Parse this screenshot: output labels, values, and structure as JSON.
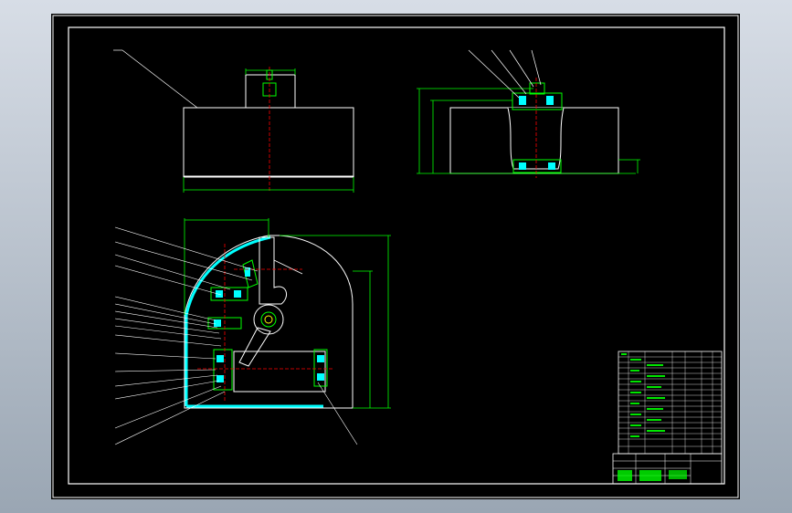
{
  "colors": {
    "background": "#000000",
    "frame": "#FFFFFF",
    "green": "#00FF00",
    "red": "#FF0000",
    "cyan": "#00FFFF",
    "yellow": "#FFFF00"
  },
  "title_block": {
    "labels": [
      "",
      "",
      "",
      "",
      ""
    ]
  }
}
